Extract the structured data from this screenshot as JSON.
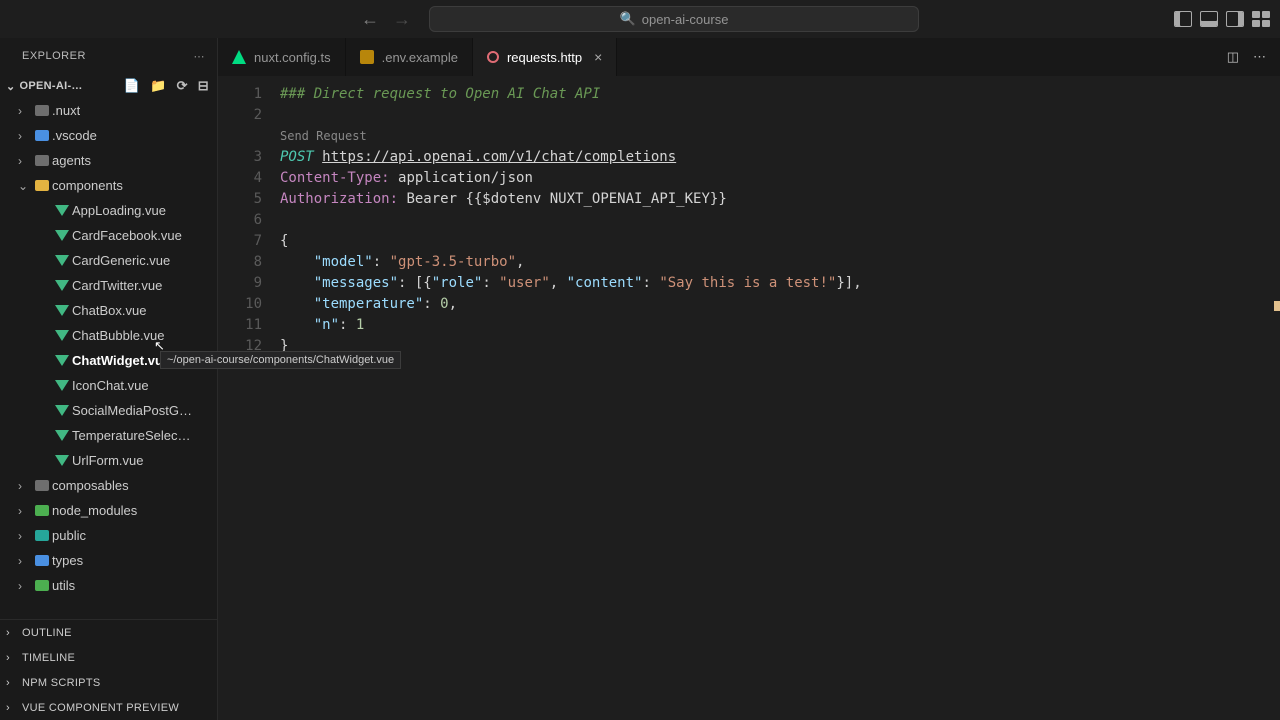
{
  "titlebar": {
    "project": "open-ai-course"
  },
  "sidebar": {
    "title": "EXPLORER",
    "project_name": "OPEN-AI-…",
    "tree": [
      {
        "type": "folder",
        "label": ".nuxt",
        "color": "gray",
        "expanded": false,
        "depth": 1
      },
      {
        "type": "folder",
        "label": ".vscode",
        "color": "blue",
        "expanded": false,
        "depth": 1
      },
      {
        "type": "folder",
        "label": "agents",
        "color": "gray",
        "expanded": false,
        "depth": 1
      },
      {
        "type": "folder",
        "label": "components",
        "color": "yellow",
        "expanded": true,
        "depth": 1
      },
      {
        "type": "file",
        "label": "AppLoading.vue",
        "icon": "vue",
        "depth": 2
      },
      {
        "type": "file",
        "label": "CardFacebook.vue",
        "icon": "vue",
        "depth": 2
      },
      {
        "type": "file",
        "label": "CardGeneric.vue",
        "icon": "vue",
        "depth": 2
      },
      {
        "type": "file",
        "label": "CardTwitter.vue",
        "icon": "vue",
        "depth": 2
      },
      {
        "type": "file",
        "label": "ChatBox.vue",
        "icon": "vue",
        "depth": 2
      },
      {
        "type": "file",
        "label": "ChatBubble.vue",
        "icon": "vue",
        "depth": 2
      },
      {
        "type": "file",
        "label": "ChatWidget.vue",
        "icon": "vue",
        "depth": 2,
        "selected": true
      },
      {
        "type": "file",
        "label": "IconChat.vue",
        "icon": "vue",
        "depth": 2
      },
      {
        "type": "file",
        "label": "SocialMediaPostG…",
        "icon": "vue",
        "depth": 2
      },
      {
        "type": "file",
        "label": "TemperatureSelec…",
        "icon": "vue",
        "depth": 2
      },
      {
        "type": "file",
        "label": "UrlForm.vue",
        "icon": "vue",
        "depth": 2
      },
      {
        "type": "folder",
        "label": "composables",
        "color": "gray",
        "expanded": false,
        "depth": 1
      },
      {
        "type": "folder",
        "label": "node_modules",
        "color": "green",
        "expanded": false,
        "depth": 1
      },
      {
        "type": "folder",
        "label": "public",
        "color": "teal",
        "expanded": false,
        "depth": 1
      },
      {
        "type": "folder",
        "label": "types",
        "color": "blue",
        "expanded": false,
        "depth": 1
      },
      {
        "type": "folder",
        "label": "utils",
        "color": "green",
        "expanded": false,
        "depth": 1
      }
    ],
    "panels": [
      "OUTLINE",
      "TIMELINE",
      "NPM SCRIPTS",
      "VUE COMPONENT PREVIEW"
    ]
  },
  "tabs": [
    {
      "label": "nuxt.config.ts",
      "icon": "nuxt",
      "active": false
    },
    {
      "label": ".env.example",
      "icon": "env",
      "active": false
    },
    {
      "label": "requests.http",
      "icon": "http",
      "active": true,
      "close": true
    }
  ],
  "tooltip": "~/open-ai-course/components/ChatWidget.vue",
  "editor": {
    "lines": [
      {
        "n": 1,
        "type": "comment",
        "text": "### Direct request to Open AI Chat API"
      },
      {
        "n": 2,
        "type": "blank",
        "text": ""
      },
      {
        "n": null,
        "type": "codelens",
        "text": "Send Request"
      },
      {
        "n": 3,
        "type": "request",
        "method": "POST",
        "url": "https://api.openai.com/v1/chat/completions"
      },
      {
        "n": 4,
        "type": "header",
        "name": "Content-Type:",
        "value": "application/json"
      },
      {
        "n": 5,
        "type": "header",
        "name": "Authorization:",
        "value": "Bearer {{$dotenv NUXT_OPENAI_API_KEY}}"
      },
      {
        "n": 6,
        "type": "blank",
        "text": ""
      },
      {
        "n": 7,
        "type": "raw",
        "text": "{"
      },
      {
        "n": 8,
        "type": "kv",
        "indent": "    ",
        "key": "\"model\"",
        "sep": ": ",
        "val": "\"gpt-3.5-turbo\"",
        "tail": ","
      },
      {
        "n": 9,
        "type": "msg",
        "indent": "    ",
        "key": "\"messages\"",
        "content_key": "\"role\"",
        "content_val": "\"user\"",
        "content_key2": "\"content\"",
        "content_val2": "\"Say this is a test!\""
      },
      {
        "n": 10,
        "type": "kv",
        "indent": "    ",
        "key": "\"temperature\"",
        "sep": ": ",
        "valnum": "0",
        "tail": ","
      },
      {
        "n": 11,
        "type": "kv",
        "indent": "    ",
        "key": "\"n\"",
        "sep": ": ",
        "valnum": "1",
        "tail": ""
      },
      {
        "n": 12,
        "type": "raw",
        "text": "}"
      }
    ]
  }
}
